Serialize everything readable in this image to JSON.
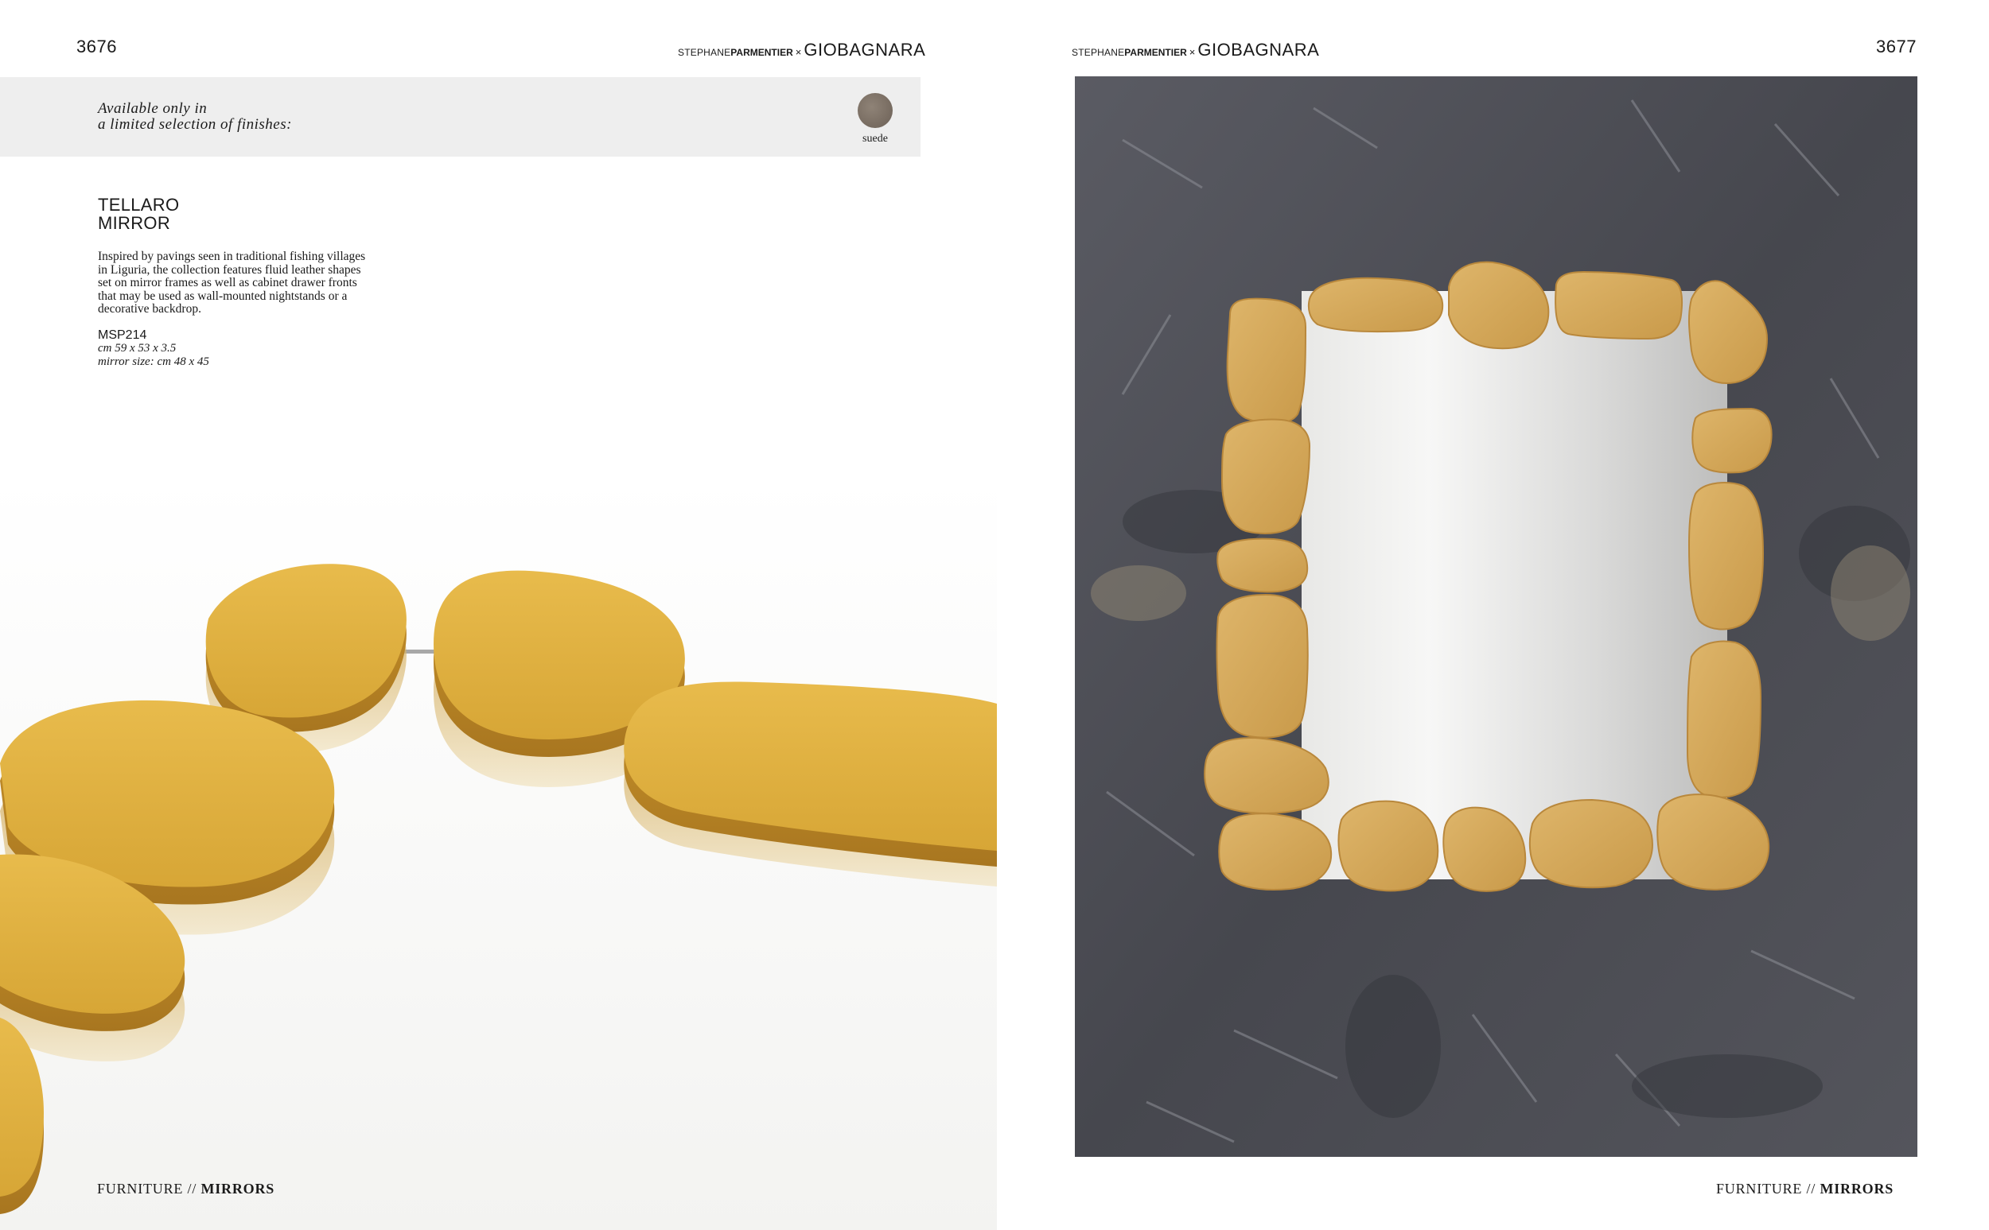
{
  "left_page": {
    "page_number": "3676",
    "brand": {
      "part1": "STEPHANE",
      "part2": "PARMENTIER",
      "separator": "×",
      "part3": "GIOBAGNARA"
    },
    "finish_note": {
      "line1": "Available only in",
      "line2": "a limited selection of finishes:"
    },
    "finish_swatch": {
      "label": "suede",
      "color": "#7d7268"
    },
    "product": {
      "title_line1": "TELLARO",
      "title_line2": "MIRROR",
      "description": [
        "Inspired by pavings seen in traditional fishing villages",
        "in Liguria, the collection features fluid leather shapes",
        "set on mirror frames as well as cabinet drawer fronts",
        "that may be used as wall-mounted nightstands or a",
        "decorative backdrop."
      ],
      "code": "MSP214",
      "dimensions": "cm 59 x 53 x 3.5",
      "mirror_size": "mirror size: cm 48 x 45"
    },
    "footer": {
      "section": "FURNITURE",
      "separator": "//",
      "category": "MIRRORS"
    }
  },
  "right_page": {
    "page_number": "3677",
    "brand": {
      "part1": "STEPHANE",
      "part2": "PARMENTIER",
      "separator": "×",
      "part3": "GIOBAGNARA"
    },
    "footer": {
      "section": "FURNITURE",
      "separator": "//",
      "category": "MIRRORS"
    }
  },
  "colors": {
    "suede_yellow": "#d9a93a",
    "stone_gray": "#4c4d54",
    "band_gray": "#eeeeee"
  }
}
